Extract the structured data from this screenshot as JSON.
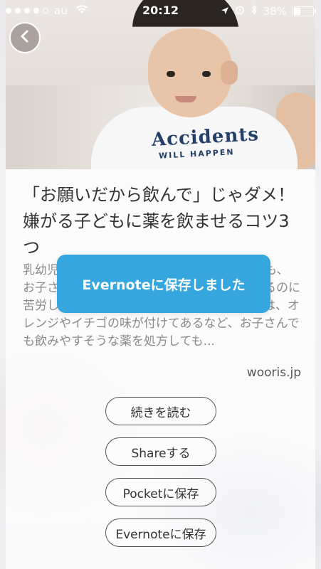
{
  "status_bar": {
    "carrier": "au",
    "time": "20:12",
    "battery": "38%",
    "battery_level": 0.38
  },
  "article": {
    "title": "「お願いだから飲んで」じゃダメ！嫌がる子どもに薬を飲ませるコツ3つ",
    "excerpt": "乳幼児の子どもの多くは薬が苦手なもの。でも、お子さんに粉薬やシロップを飲ませようとするのに苦労しているパパママは多いでしょう。最近は、オレンジやイチゴの味が付けてあるなど、お子さんでも飲みやすそうな薬を処方しても...",
    "source": "wooris.jp",
    "photo_text_main": "Accidents",
    "photo_text_sub": "WILL HAPPEN"
  },
  "actions": {
    "read_more": "続きを読む",
    "share": "Shareする",
    "pocket": "Pocketに保存",
    "evernote": "Evernoteに保存"
  },
  "toast": {
    "message": "Evernoteに保存しました"
  },
  "colors": {
    "toast_bg": "#36a6de"
  }
}
